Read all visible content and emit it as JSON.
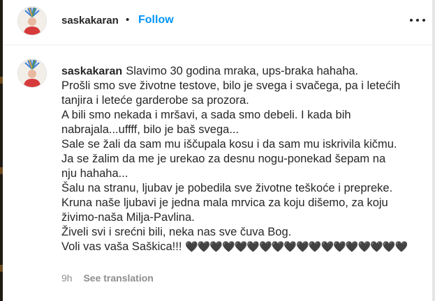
{
  "header": {
    "username": "saskakaran",
    "separator": "•",
    "follow_label": "Follow",
    "more_icon": "more-horizontal-icon"
  },
  "post": {
    "username": "saskakaran",
    "caption_lines": [
      "Slavimo 30 godina mraka, ups-braka hahaha.",
      "Prošli smo sve životne testove, bilo je svega i svačega, pa i letećih",
      "tanjira i leteće garderobe sa prozora.",
      "A bili smo nekada i mršavi, a sada smo debeli. I kada bih",
      "nabrajala...uffff, bilo je baš svega...",
      "Sale se žali da sam mu iščupala kosu i da sam mu iskrivila kičmu.",
      "Ja se žalim da me je urekao za desnu nogu-ponekad šepam na",
      "nju hahaha...",
      "Šalu na stranu, ljubav je pobedila sve životne teškoće i prepreke.",
      "Kruna naše ljubavi je jedna mala mrvica za koju dišemo, za koju",
      "živimo-naša Milja-Pavlina.",
      "Živeli svi i srećni bili, neka nas sve čuva Bog."
    ],
    "closing_text": "Voli vas vaša Saškica!!!",
    "hearts": "🖤🖤🖤🖤🖤🖤🖤🖤🖤🖤🖤🖤🖤🖤🖤🖤🖤🖤",
    "time_ago": "9h",
    "see_translation_label": "See translation"
  },
  "colors": {
    "link": "#0095f6",
    "text": "#262626",
    "muted": "#8e8e8e",
    "divider": "#efefef"
  }
}
